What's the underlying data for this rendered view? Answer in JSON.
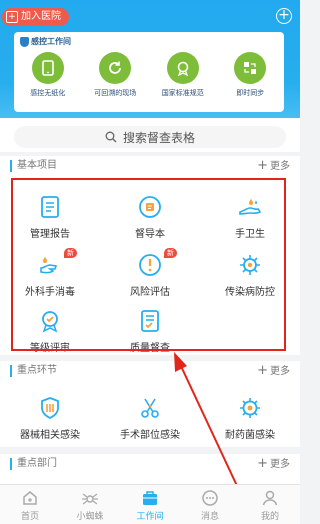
{
  "header": {
    "join_label": "加入医院",
    "add_icon": "plus-circle-icon"
  },
  "banner": {
    "brand": "感控工作间",
    "features": [
      {
        "label": "感控无纸化",
        "icon": "tablet-icon"
      },
      {
        "label": "可回溯的现场",
        "icon": "refresh-icon"
      },
      {
        "label": "国家标准规范",
        "icon": "rosette-icon"
      },
      {
        "label": "即时同步",
        "icon": "sync-icon"
      }
    ],
    "accent": "#7dbd3a"
  },
  "search": {
    "placeholder": "搜索督查表格"
  },
  "sections": {
    "basic": {
      "title": "基本项目",
      "more": "更多",
      "items": [
        {
          "label": "管理报告",
          "icon": "report-icon",
          "badge": ""
        },
        {
          "label": "督导本",
          "icon": "notebook-icon",
          "badge": ""
        },
        {
          "label": "手卫生",
          "icon": "hand-wash-icon",
          "badge": ""
        },
        {
          "label": "外科手消毒",
          "icon": "surgical-hand-icon",
          "badge": "新"
        },
        {
          "label": "风险评估",
          "icon": "risk-icon",
          "badge": "新"
        },
        {
          "label": "传染病防控",
          "icon": "virus-icon",
          "badge": ""
        },
        {
          "label": "等级评审",
          "icon": "level-icon",
          "badge": ""
        },
        {
          "label": "质量督查",
          "icon": "quality-icon",
          "badge": ""
        }
      ]
    },
    "key_links": {
      "title": "重点环节",
      "more": "更多",
      "items": [
        {
          "label": "器械相关感染",
          "icon": "device-icon"
        },
        {
          "label": "手术部位感染",
          "icon": "surgery-tools-icon"
        },
        {
          "label": "耐药菌感染",
          "icon": "bacteria-icon"
        }
      ]
    },
    "key_depts": {
      "title": "重点部门",
      "more": "更多"
    }
  },
  "tabbar": [
    {
      "label": "首页",
      "icon": "home-icon",
      "active": false
    },
    {
      "label": "小蜘蛛",
      "icon": "spider-icon",
      "active": false
    },
    {
      "label": "工作间",
      "icon": "workspace-icon",
      "active": true
    },
    {
      "label": "消息",
      "icon": "message-icon",
      "active": false
    },
    {
      "label": "我的",
      "icon": "user-icon",
      "active": false
    }
  ],
  "colors": {
    "primary": "#27aeee",
    "highlight_frame": "#e1251b",
    "badge": "#f0493d"
  }
}
